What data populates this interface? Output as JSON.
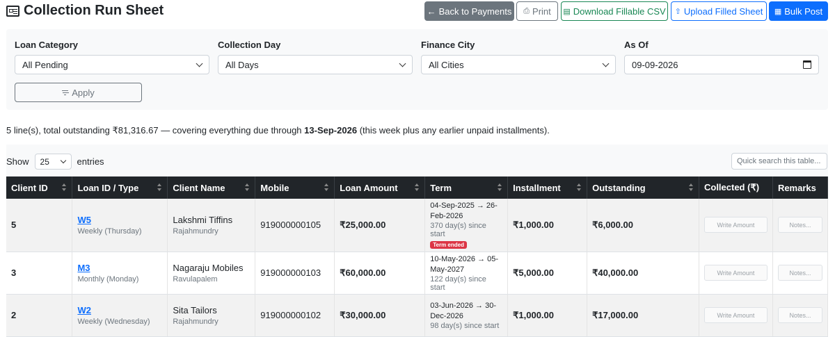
{
  "header": {
    "title": "Collection Run Sheet",
    "buttons": {
      "back": "Back to Payments",
      "print": "Print",
      "download_csv": "Download Fillable CSV",
      "upload": "Upload Filled Sheet",
      "bulk_post": "Bulk Post"
    }
  },
  "filters": {
    "loan_category": {
      "label": "Loan Category",
      "value": "All Pending"
    },
    "collection_day": {
      "label": "Collection Day",
      "value": "All Days"
    },
    "finance_city": {
      "label": "Finance City",
      "value": "All Cities"
    },
    "as_of": {
      "label": "As Of",
      "value": "09-09-2026"
    },
    "apply_label": "Apply"
  },
  "summary": {
    "prefix": "5 line(s), total outstanding ₹81,316.67 — covering everything due through",
    "date": "13-Sep-2026",
    "suffix": "(this week plus any earlier unpaid installments)."
  },
  "table_controls": {
    "show_label": "Show",
    "page_size": "25",
    "entries_label": "entries",
    "search_placeholder": "Quick search this table..."
  },
  "table": {
    "columns": [
      "Client ID",
      "Loan ID / Type",
      "Client Name",
      "Mobile",
      "Loan Amount",
      "Term",
      "Installment",
      "Outstanding",
      "Collected (₹)",
      "Remarks"
    ],
    "rows": [
      {
        "client_id": "5",
        "loan_id": "W5",
        "loan_type": "Weekly (Thursday)",
        "client_name": "Lakshmi Tiffins",
        "city": "Rajahmundry",
        "mobile": "919000000105",
        "loan_amount": "₹25,000.00",
        "term_range": "04-Sep-2025 → 26-Feb-2026",
        "term_days": "370 day(s) since start",
        "term_badge": "Term ended",
        "installment": "₹1,000.00",
        "outstanding": "₹6,000.00",
        "collected_placeholder": "Write Amount",
        "remarks_placeholder": "Notes..."
      },
      {
        "client_id": "3",
        "loan_id": "M3",
        "loan_type": "Monthly (Monday)",
        "client_name": "Nagaraju Mobiles",
        "city": "Ravulapalem",
        "mobile": "919000000103",
        "loan_amount": "₹60,000.00",
        "term_range": "10-May-2026 → 05-May-2027",
        "term_days": "122 day(s) since start",
        "term_badge": "",
        "installment": "₹5,000.00",
        "outstanding": "₹40,000.00",
        "collected_placeholder": "Write Amount",
        "remarks_placeholder": "Notes..."
      },
      {
        "client_id": "2",
        "loan_id": "W2",
        "loan_type": "Weekly (Wednesday)",
        "client_name": "Sita Tailors",
        "city": "Rajahmundry",
        "mobile": "919000000102",
        "loan_amount": "₹30,000.00",
        "term_range": "03-Jun-2026 → 30-Dec-2026",
        "term_days": "98 day(s) since start",
        "term_badge": "",
        "installment": "₹1,000.00",
        "outstanding": "₹17,000.00",
        "collected_placeholder": "Write Amount",
        "remarks_placeholder": "Notes..."
      }
    ]
  },
  "colors": {
    "primary": "#0d6efd",
    "secondary": "#6c757d",
    "success": "#198754",
    "danger": "#dc3545",
    "header_dark": "#212529"
  }
}
